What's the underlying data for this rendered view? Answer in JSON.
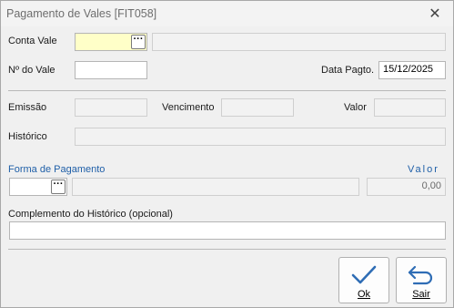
{
  "window": {
    "title": "Pagamento de Vales [FIT058]",
    "close_glyph": "✕"
  },
  "form": {
    "conta_vale_label": "Conta Vale",
    "conta_vale_value": "",
    "conta_vale_desc": "",
    "num_vale_label": "Nº do Vale",
    "num_vale_value": "",
    "data_pagto_label": "Data Pagto.",
    "data_pagto_value": "15/12/2025",
    "emissao_label": "Emissão",
    "emissao_value": "",
    "vencimento_label": "Vencimento",
    "vencimento_value": "",
    "valor_label": "Valor",
    "valor_value": "",
    "historico_label": "Histórico",
    "historico_value": "",
    "forma_pagamento_label": "Forma de Pagamento",
    "forma_pagamento_code": "",
    "forma_pagamento_desc": "",
    "valor_pagamento_label": "Valor",
    "valor_pagamento_value": "0,00",
    "complemento_label": "Complemento do Histórico (opcional)",
    "complemento_value": "",
    "lookup_glyph": "···"
  },
  "buttons": {
    "ok_label": "Ok",
    "sair_label": "Sair"
  },
  "colors": {
    "accent": "#1f5fa8",
    "required_field": "#ffffc8"
  },
  "icons": [
    "close-icon",
    "ellipsis-icon",
    "checkmark-icon",
    "return-arrow-icon"
  ]
}
